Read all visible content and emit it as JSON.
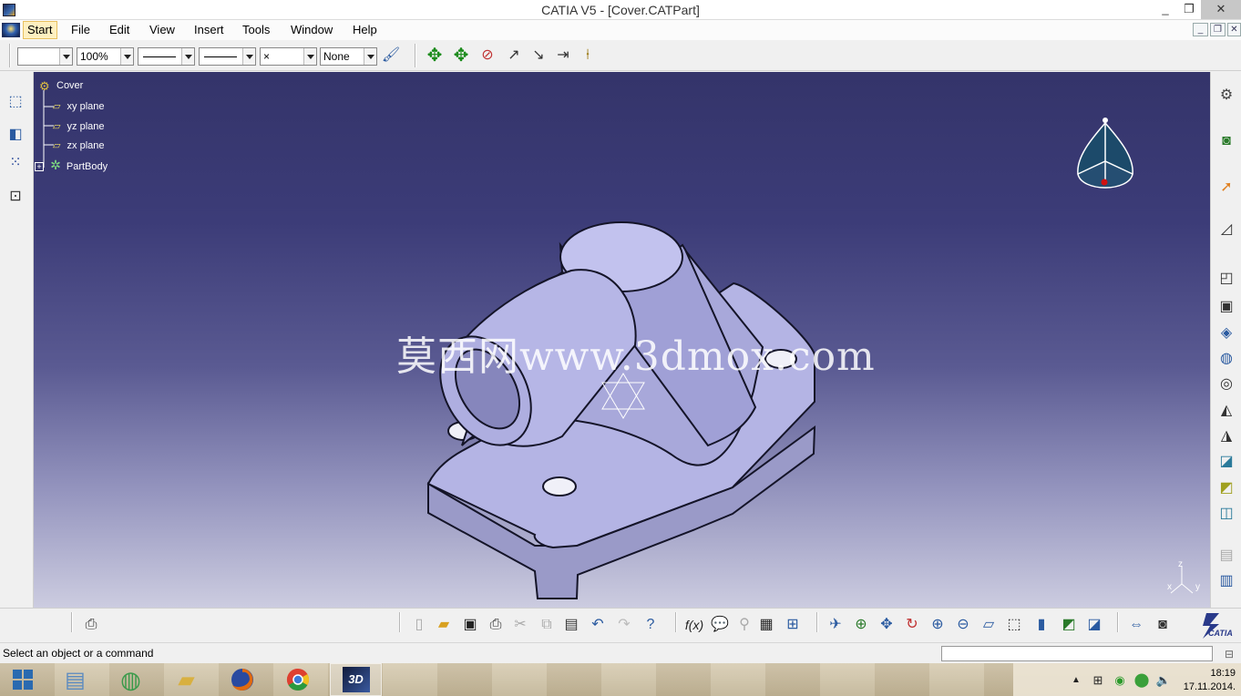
{
  "window": {
    "title": "CATIA V5 - [Cover.CATPart]",
    "controls": {
      "minimize": "_",
      "maximize": "❐",
      "close": "✕"
    }
  },
  "menu": {
    "items": [
      "Start",
      "File",
      "Edit",
      "View",
      "Insert",
      "Tools",
      "Window",
      "Help"
    ],
    "mdi_controls": {
      "minimize": "_",
      "restore": "❐",
      "close": "✕"
    }
  },
  "toolbar": {
    "color_combo": "",
    "transparency_combo": "100%",
    "linetype_combo": "",
    "thickness_combo": "",
    "point_combo": "×",
    "layer_combo": "None"
  },
  "tree": {
    "root": "Cover",
    "items": [
      "xy plane",
      "yz plane",
      "zx plane",
      "PartBody"
    ]
  },
  "viewport": {
    "watermark": "莫西网www.3dmox.com",
    "axis_labels": {
      "x": "x",
      "y": "y",
      "z": "z"
    }
  },
  "status": {
    "message": "Select an object or a command",
    "command_input": ""
  },
  "bottom_logo": "CATIA",
  "taskbar": {
    "apps": [
      "windows-start",
      "catalog",
      "earth",
      "file-explorer",
      "firefox",
      "chrome",
      "catia"
    ],
    "clock_time": "18:19",
    "clock_date": "17.11.2014."
  },
  "colors": {
    "viewport_top": "#34346a",
    "viewport_bottom": "#cccce0",
    "part_fill": "#b4b4e4",
    "part_edge": "#141428",
    "compass_fill": "#1c4a6a"
  }
}
